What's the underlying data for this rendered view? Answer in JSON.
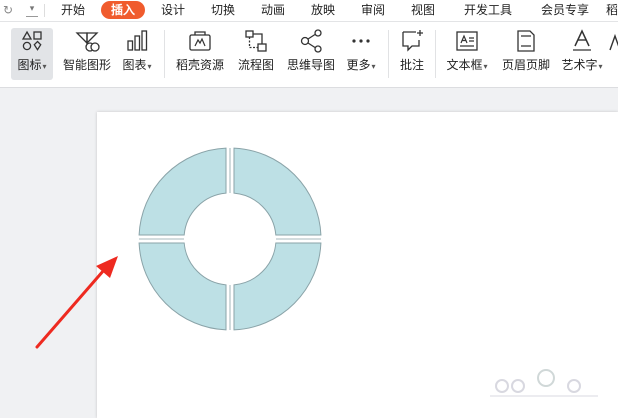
{
  "menu": {
    "tabs": [
      {
        "label": "开始"
      },
      {
        "label": "插入",
        "active": true
      },
      {
        "label": "设计"
      },
      {
        "label": "切换"
      },
      {
        "label": "动画"
      },
      {
        "label": "放映"
      },
      {
        "label": "审阅"
      },
      {
        "label": "视图"
      },
      {
        "label": "开发工具"
      },
      {
        "label": "会员专享"
      },
      {
        "label": "稻"
      }
    ]
  },
  "ribbon": {
    "icons_label": "图标",
    "smart_graphic_label": "智能图形",
    "chart_label": "图表",
    "docer_label": "稻壳资源",
    "flowchart_label": "流程图",
    "mindmap_label": "思维导图",
    "more_label": "更多",
    "comment_label": "批注",
    "textbox_label": "文本框",
    "header_footer_label": "页眉页脚",
    "wordart_label": "艺术字"
  },
  "shape": {
    "type": "donut",
    "fill": "#bde0e5",
    "stroke": "#8aa3a8",
    "segments": 4
  },
  "annotation": {
    "arrow_color": "#ee2a20"
  },
  "colors": {
    "accent": "#f05b2d",
    "ribbon_bg": "#ffffff",
    "canvas_bg": "#f0f1f3"
  }
}
